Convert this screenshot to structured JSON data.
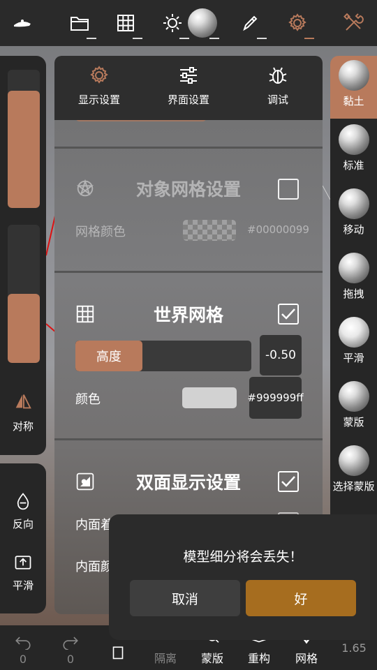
{
  "colors": {
    "accent": "#b87a5c",
    "confirm": "#a66d1f",
    "panel": "#262626",
    "ok_gold": "#a66d1f"
  },
  "toolbar": {
    "icons": [
      "sculpt-logo-icon",
      "folder-icon",
      "grid-icon",
      "sun-icon",
      "matcap-sphere",
      "brush-icon",
      "gear-icon",
      "tools-icon"
    ]
  },
  "left_panel": {
    "radius_fill_pct": 85,
    "intensity_fill_pct": 50,
    "symmetry_label": "对称",
    "invert_label": "反向",
    "smooth_label": "平滑"
  },
  "right_tools": [
    {
      "label": "黏土",
      "active": true
    },
    {
      "label": "标准",
      "active": false
    },
    {
      "label": "移动",
      "active": false
    },
    {
      "label": "拖拽",
      "active": false
    },
    {
      "label": "平滑",
      "active": false
    },
    {
      "label": "蒙版",
      "active": false
    },
    {
      "label": "选择蒙版",
      "active": false
    }
  ],
  "settings": {
    "tabs": [
      {
        "label": "显示设置"
      },
      {
        "label": "界面设置"
      },
      {
        "label": "调试"
      }
    ],
    "object_grid": {
      "title": "对象网格设置",
      "color_label": "网格颜色",
      "color_value": "#00000099",
      "checked": false
    },
    "world_grid": {
      "title": "世界网格",
      "height_label": "高度",
      "height_value": "-0.50",
      "height_fill_pct": 38,
      "color_label": "颜色",
      "color_value": "#999999ff",
      "checked": true
    },
    "double_sided": {
      "title": "双面显示设置",
      "inner_color_label": "内面着色",
      "inner_face_label": "内面颜色",
      "checked": true
    }
  },
  "dialog": {
    "message": "模型细分将会丢失！",
    "cancel": "取消",
    "ok": "好"
  },
  "bottom_bar": {
    "undo_count": "0",
    "redo_count": "0",
    "isolate": "隔离",
    "mask": "蒙版",
    "remesh": "重构",
    "mesh": "网格",
    "version": "1.65"
  }
}
